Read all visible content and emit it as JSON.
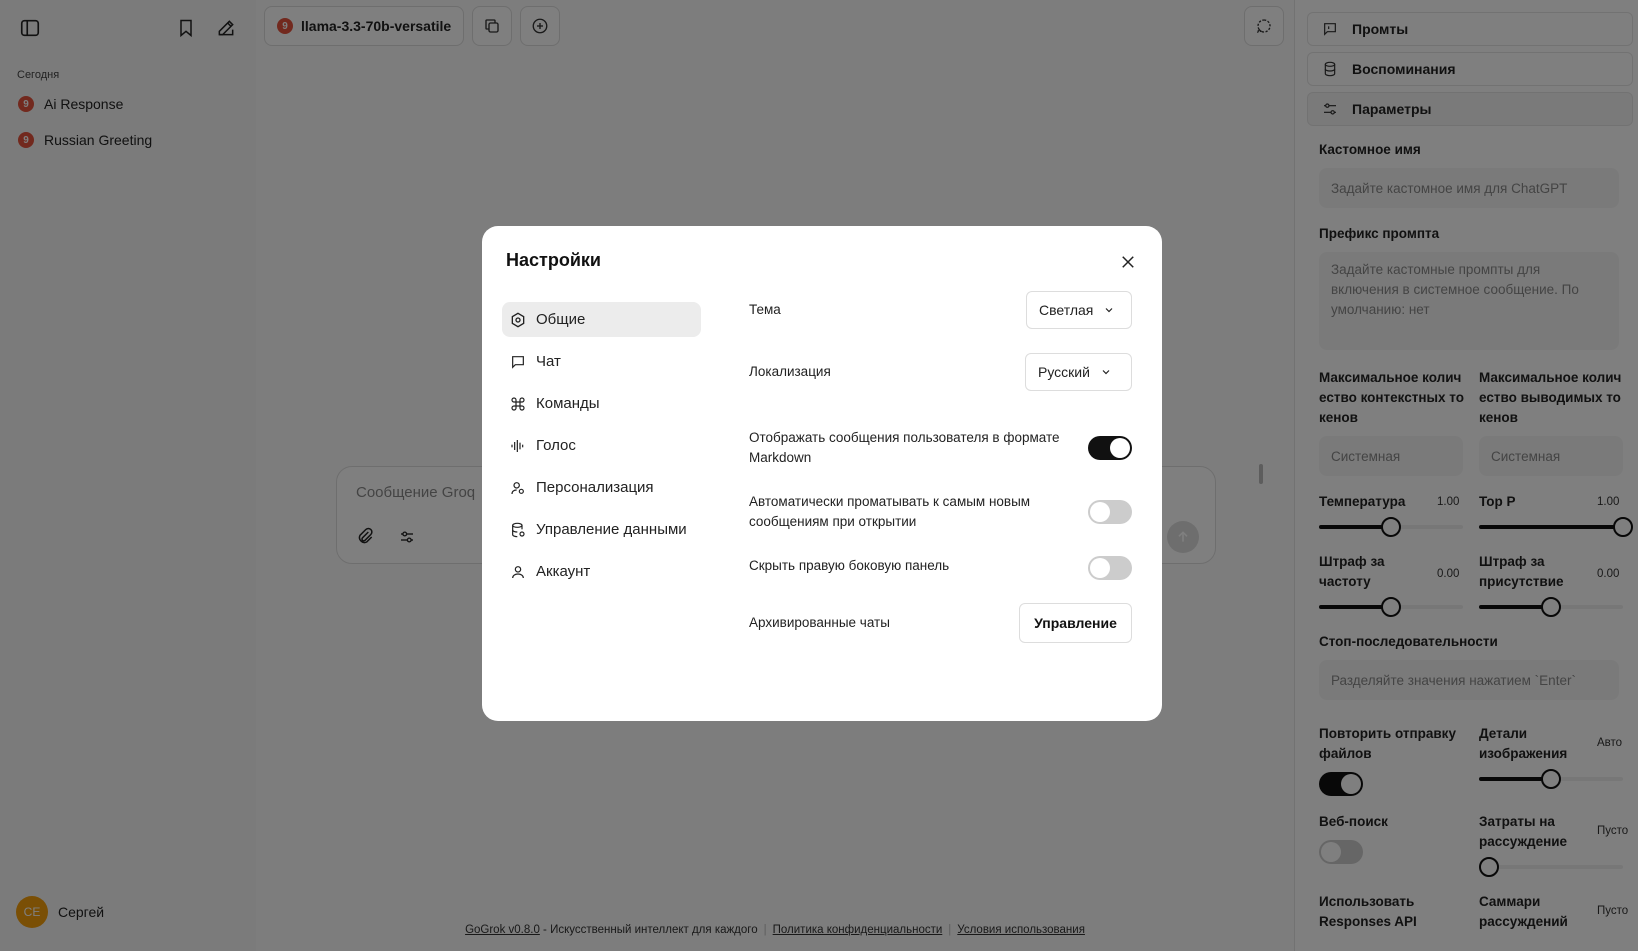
{
  "sidebar": {
    "section_today": "Сегодня",
    "chats": [
      {
        "title": "Ai Response",
        "badge": "9"
      },
      {
        "title": "Russian Greeting",
        "badge": "9"
      }
    ],
    "user": {
      "initials": "CE",
      "name": "Сергей"
    }
  },
  "main": {
    "model_badge": "9",
    "model_name": "llama-3.3-70b-versatile",
    "composer_placeholder": "Сообщение Groq",
    "footer": {
      "version_link": "GoGrok v0.8.0",
      "tagline": " - Искусственный интеллект для каждого",
      "privacy": "Политика конфиденциальности",
      "terms": "Условия использования"
    }
  },
  "right_panel": {
    "tabs": [
      {
        "label": "Промты",
        "icon": "message-icon"
      },
      {
        "label": "Воспоминания",
        "icon": "database-icon"
      },
      {
        "label": "Параметры",
        "icon": "sliders-icon"
      }
    ],
    "custom_name_label": "Кастомное имя",
    "custom_name_placeholder": "Задайте кастомное имя для ChatGPT",
    "prompt_prefix_label": "Префикс промпта",
    "prompt_prefix_placeholder": "Задайте кастомные промпты для включения в системное сообщение. По умолчанию: нет",
    "max_context_label": "Максимальное колич ество контекстных то кенов",
    "max_output_label": "Максимальное колич ество выводимых то кенов",
    "max_context_value": "Системная",
    "max_output_value": "Системная",
    "temperature_label": "Температура",
    "temperature_value": "1.00",
    "temperature_level": 0.5,
    "top_p_label": "Top P",
    "top_p_value": "1.00",
    "top_p_level": 1.0,
    "freq_penalty_label": "Штраф за частоту",
    "freq_penalty_value": "0.00",
    "freq_penalty_level": 0.5,
    "presence_penalty_label": "Штраф за присутствие",
    "presence_penalty_value": "0.00",
    "presence_penalty_level": 0.5,
    "stop_seq_label": "Стоп-последовательности",
    "stop_seq_placeholder": "Разделяйте значения нажатием `Enter`",
    "resend_files_label": "Повторить отправку файлов",
    "resend_files_on": true,
    "image_detail_label": "Детали изображения",
    "image_detail_value": "Авто",
    "image_detail_level": 0.5,
    "web_search_label": "Веб-поиск",
    "web_search_on": false,
    "reasoning_effort_label": "Затраты на рассуждение",
    "reasoning_effort_value": "Пусто",
    "reasoning_effort_level": 0.0,
    "responses_api_label": "Использовать Responses API",
    "reasoning_summary_label": "Саммари рассуждений",
    "reasoning_summary_value": "Пусто"
  },
  "modal": {
    "title": "Настройки",
    "nav": [
      {
        "label": "Общие",
        "icon": "gear-icon",
        "active": true
      },
      {
        "label": "Чат",
        "icon": "message-icon"
      },
      {
        "label": "Команды",
        "icon": "command-icon"
      },
      {
        "label": "Голос",
        "icon": "audio-icon"
      },
      {
        "label": "Персонализация",
        "icon": "person-settings-icon"
      },
      {
        "label": "Управление данными",
        "icon": "database-icon"
      },
      {
        "label": "Аккаунт",
        "icon": "user-icon"
      }
    ],
    "theme_label": "Тема",
    "theme_value": "Светлая",
    "locale_label": "Локализация",
    "locale_value": "Русский",
    "markdown_label": "Отображать сообщения пользователя в формате Markdown",
    "markdown_on": true,
    "autoscroll_label": "Автоматически проматывать к самым новым сообщениям при открытии",
    "autoscroll_on": false,
    "hide_panel_label": "Скрыть правую боковую панель",
    "hide_panel_on": false,
    "archived_label": "Архивированные чаты",
    "manage_button": "Управление"
  }
}
